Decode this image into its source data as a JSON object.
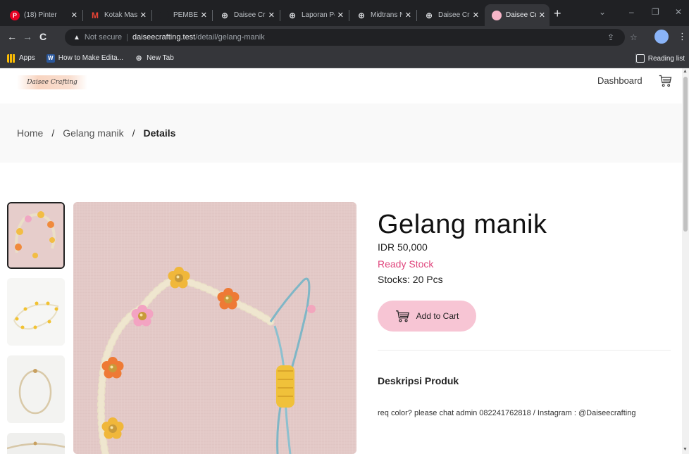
{
  "browser": {
    "tabs": [
      {
        "label": "(18) Pinter",
        "favicon": "pinterest-icon",
        "color": "#e60023",
        "glyph": "P"
      },
      {
        "label": "Kotak Mas",
        "favicon": "gmail-icon",
        "color": "#ea4335",
        "glyph": "M"
      },
      {
        "label": "PEMBELA",
        "favicon": "blank-icon",
        "color": "#202124",
        "glyph": ""
      },
      {
        "label": "Daisee Cra",
        "favicon": "globe-icon",
        "color": "#9aa0a6",
        "glyph": "⊕"
      },
      {
        "label": "Laporan Pe",
        "favicon": "globe-icon",
        "color": "#9aa0a6",
        "glyph": "⊕"
      },
      {
        "label": "Midtrans N",
        "favicon": "globe-icon",
        "color": "#9aa0a6",
        "glyph": "⊕"
      },
      {
        "label": "Daisee Cra",
        "favicon": "globe-icon",
        "color": "#9aa0a6",
        "glyph": "⊕"
      },
      {
        "label": "Daisee Cra",
        "favicon": "pink-dot-icon",
        "color": "#f7b5c8",
        "glyph": "",
        "active": true
      }
    ],
    "new_tab_glyph": "+",
    "close_glyph": "✕",
    "address": {
      "warning": "▲",
      "not_secure": "Not secure",
      "host": "daiseecrafting.test",
      "path": "/detail/gelang-manik"
    },
    "bookmarks": [
      {
        "label": "Apps",
        "icon": "apps-grid-icon"
      },
      {
        "label": "How to Make Edita...",
        "icon": "word-icon"
      },
      {
        "label": "New Tab",
        "icon": "globe-icon"
      }
    ],
    "reading_list": "Reading list"
  },
  "site": {
    "logo_text": "Daisee Crafting",
    "nav_dashboard": "Dashboard",
    "breadcrumb": {
      "home": "Home",
      "category": "Gelang manik",
      "current": "Details",
      "separator": "/"
    },
    "product": {
      "title": "Gelang manik",
      "price": "IDR 50,000",
      "status": "Ready Stock",
      "stock": "Stocks: 20 Pcs",
      "add_to_cart": "Add to Cart"
    },
    "description": {
      "heading": "Deskripsi Produk",
      "text": "req color? please chat admin 082241762818 / Instagram : @Daiseecrafting"
    }
  },
  "colors": {
    "accent_pink": "#f7c5d4",
    "status_pink": "#e0467d",
    "chrome_dark": "#202124"
  }
}
